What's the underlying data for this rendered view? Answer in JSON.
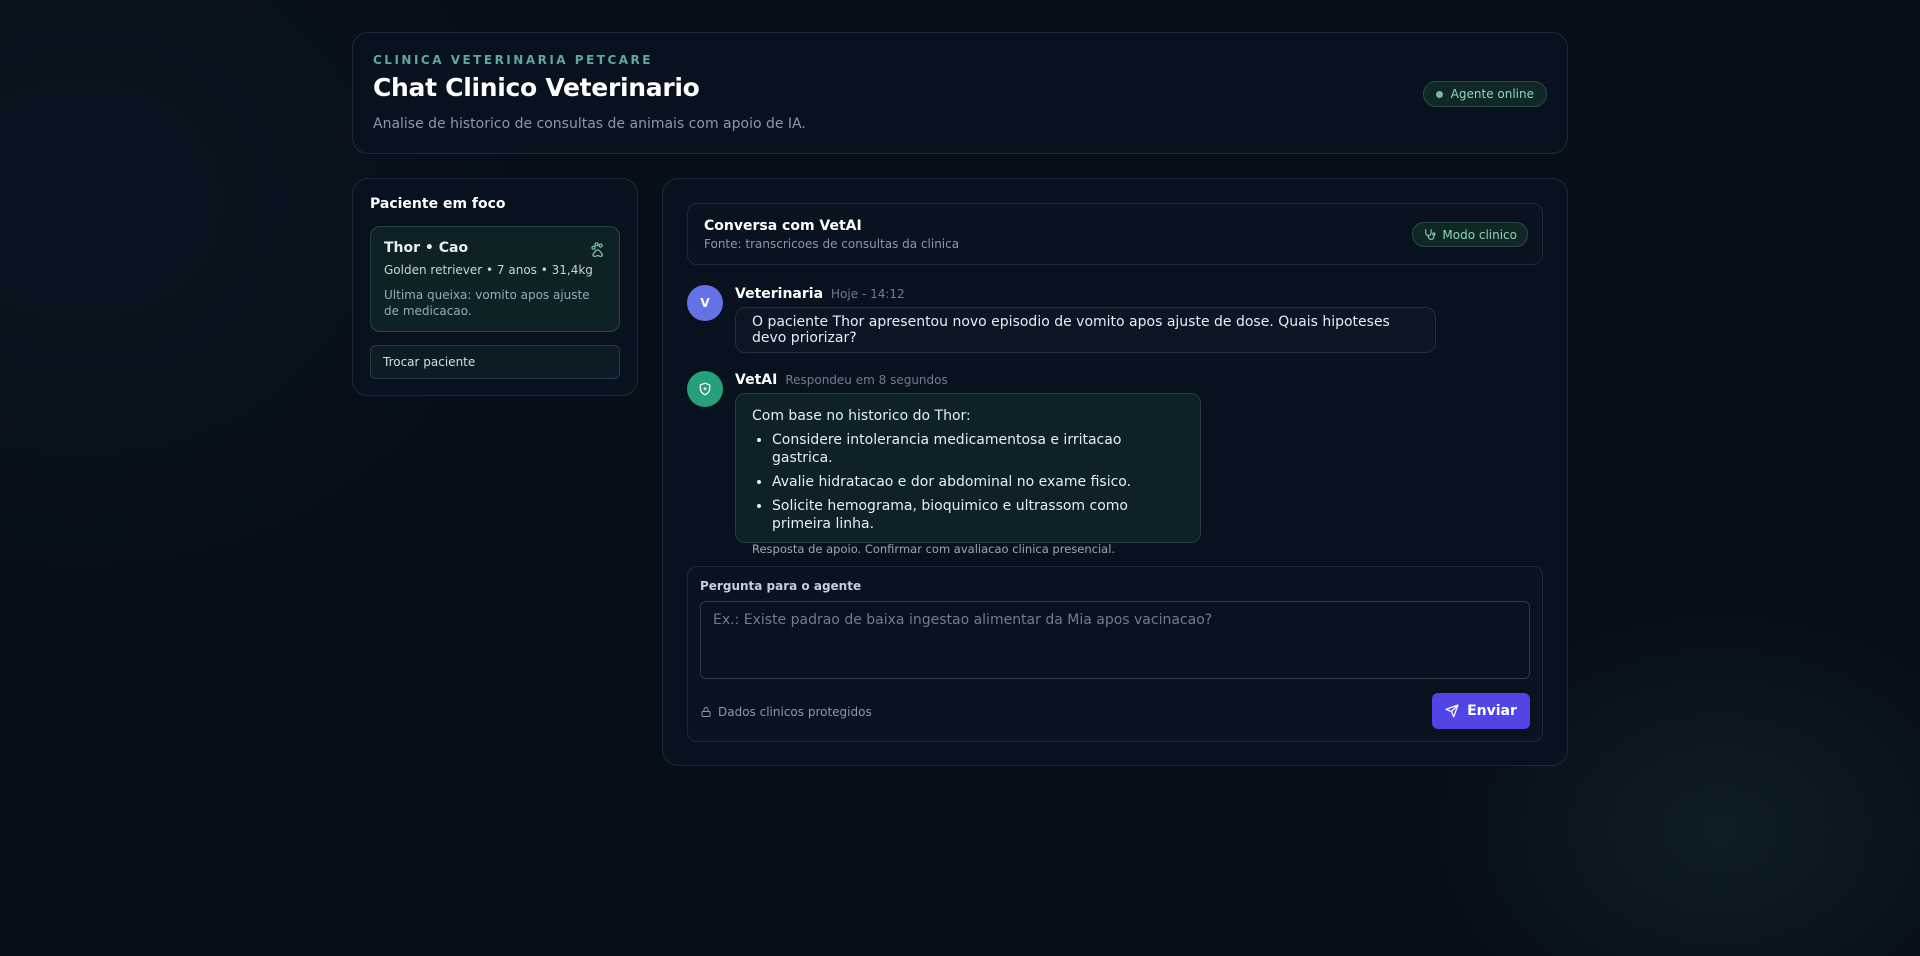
{
  "header": {
    "eyebrow": "CLINICA VETERINARIA PETCARE",
    "title": "Chat Clinico Veterinario",
    "subtitle": "Analise de historico de consultas de animais com apoio de IA.",
    "status": "Agente online"
  },
  "patient": {
    "section_title": "Paciente em foco",
    "name": "Thor • Cao",
    "meta": "Golden retriever • 7 anos • 31,4kg",
    "note": "Ultima queixa: vomito apos ajuste de medicacao.",
    "switch_label": "Trocar paciente"
  },
  "chat": {
    "title": "Conversa com VetAI",
    "source": "Fonte: transcricoes de consultas da clinica",
    "mode": "Modo clinico",
    "messages": [
      {
        "avatar": "V",
        "author": "Veterinaria",
        "time": "Hoje - 14:12",
        "text": "O paciente Thor apresentou novo episodio de vomito apos ajuste de dose. Quais hipoteses devo priorizar?"
      },
      {
        "author": "VetAI",
        "time": "Respondeu em 8 segundos",
        "intro": "Com base no historico do Thor:",
        "items": [
          "Considere intolerancia medicamentosa e irritacao gastrica.",
          "Avalie hidratacao e dor abdominal no exame fisico.",
          "Solicite hemograma, bioquimico e ultrassom como primeira linha."
        ],
        "disclaimer": "Resposta de apoio. Confirmar com avaliacao clinica presencial."
      }
    ]
  },
  "composer": {
    "label": "Pergunta para o agente",
    "placeholder": "Ex.: Existe padrao de baixa ingestao alimentar da Mia apos vacinacao?",
    "secure_note": "Dados clinicos protegidos",
    "send_label": "Enviar"
  },
  "colors": {
    "accent": "#4f46e5",
    "ai_avatar": "#25a07b",
    "vet_avatar": "#6373e6",
    "status_teal": "#8fd3c3"
  }
}
